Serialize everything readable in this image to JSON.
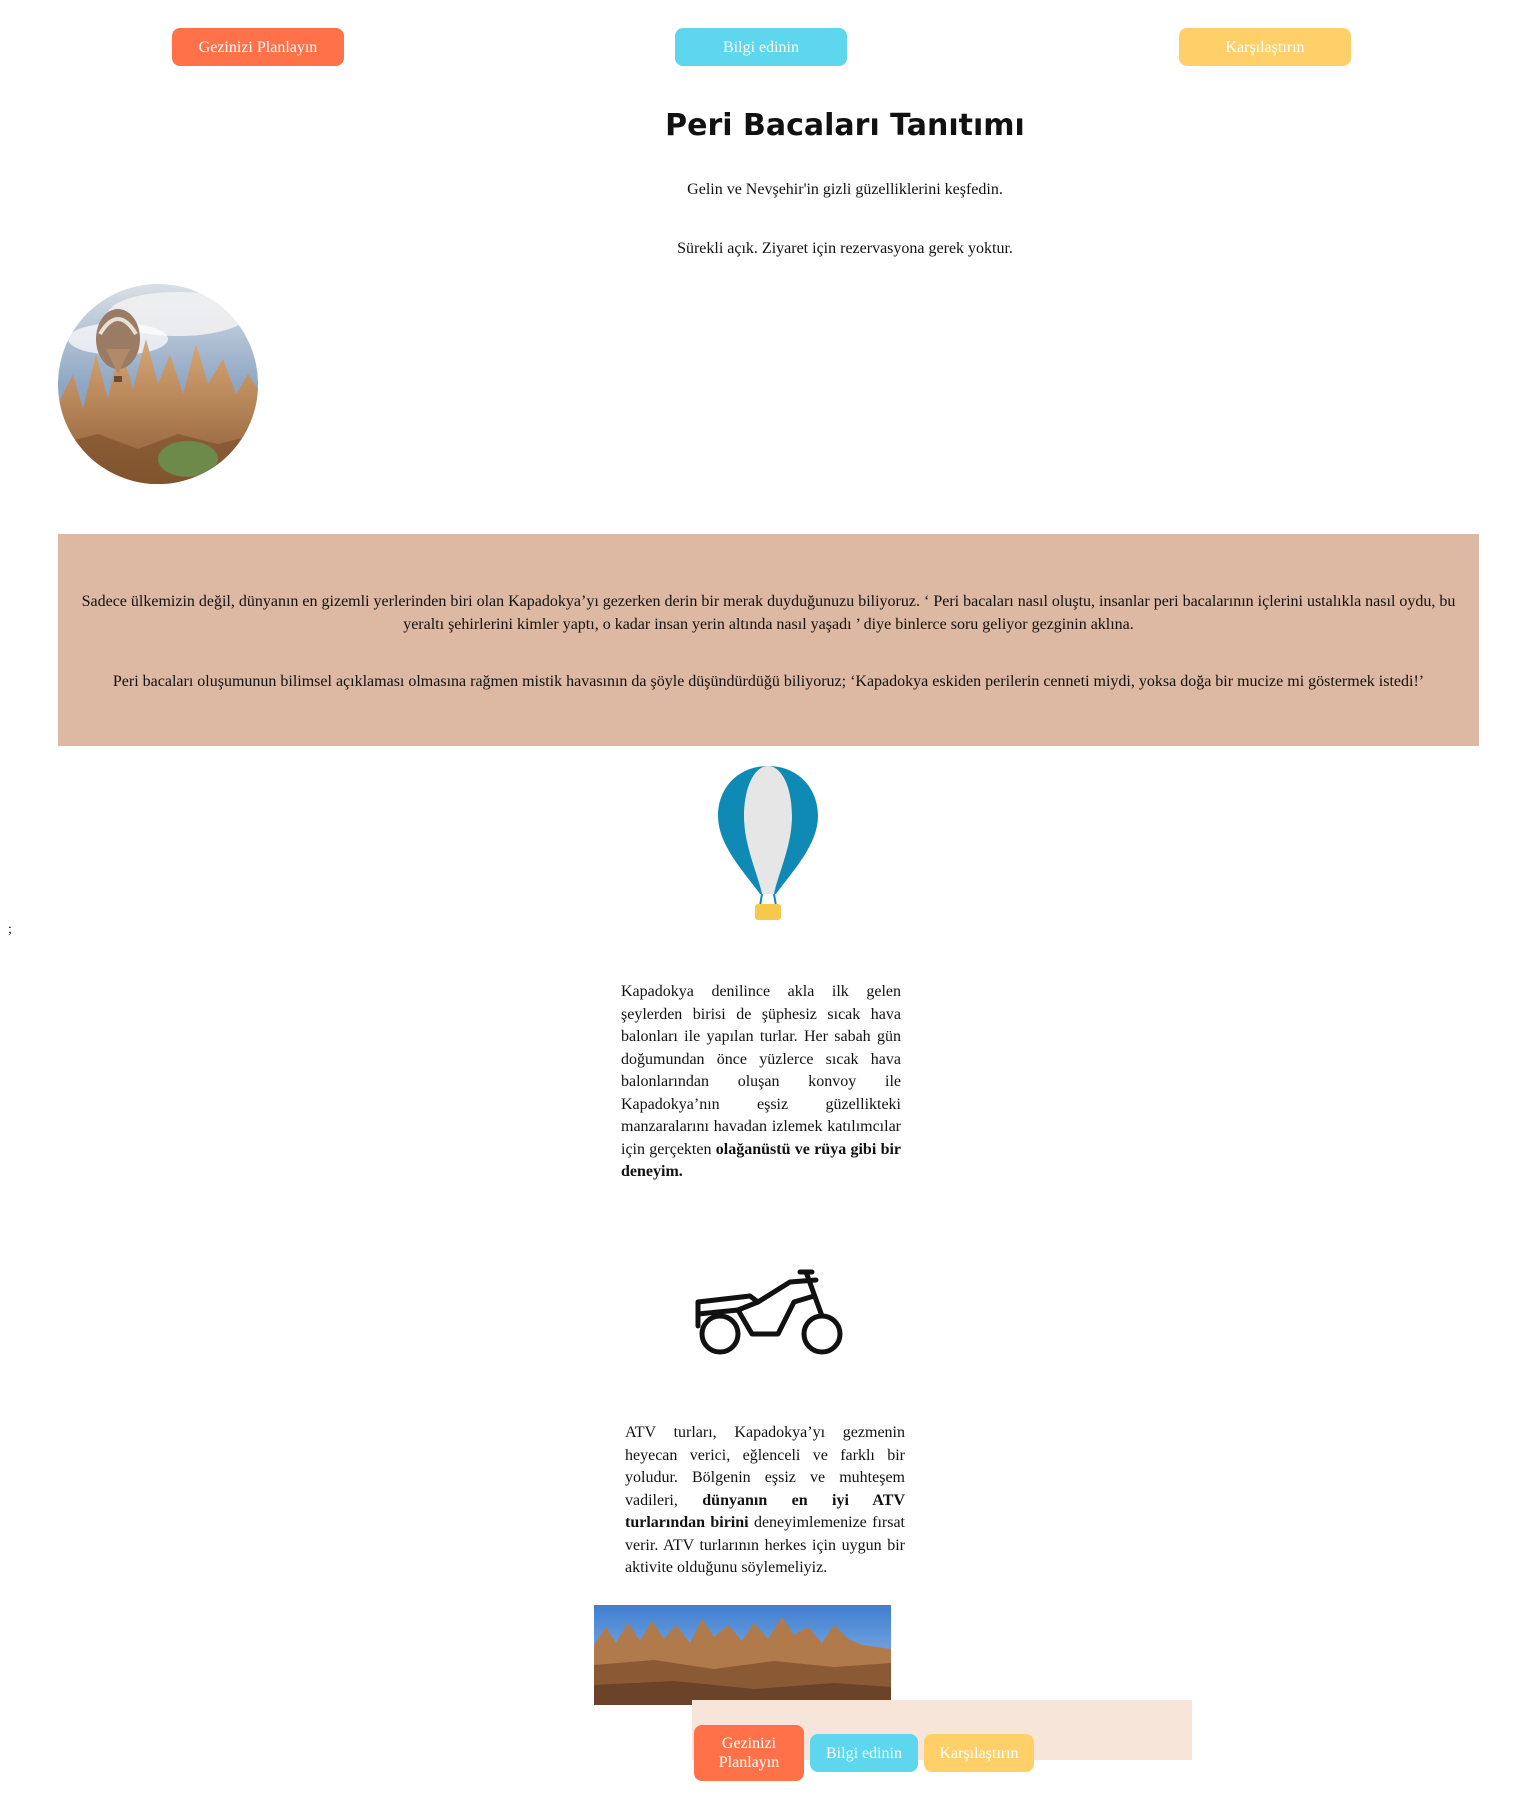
{
  "nav": {
    "plan_label": "Gezinizi Planlayın",
    "info_label": "Bilgi edinin",
    "compare_label": "Karşılaştırın"
  },
  "header": {
    "title": "Peri Bacaları Tanıtımı",
    "subtitle": "Gelin ve Nevşehir'in gizli güzelliklerini keşfedin.",
    "notice": "Sürekli açık. Ziyaret için rezervasyona gerek yoktur."
  },
  "intro": {
    "paragraph1": "Sadece ülkemizin değil, dünyanın en gizemli yerlerinden biri olan Kapadokya’yı gezerken derin bir merak duyduğunuzu biliyoruz. ‘ Peri bacaları nasıl oluştu, insanlar peri bacalarının içlerini ustalıkla nasıl oydu, bu yeraltı şehirlerini kimler yaptı, o kadar insan yerin altında nasıl yaşadı ’ diye binlerce soru geliyor gezginin aklına.",
    "paragraph2": "Peri bacaları oluşumunun bilimsel açıklaması olmasına rağmen mistik havasının da şöyle düşündürdüğü biliyoruz; ‘Kapadokya eskiden perilerin cenneti miydi, yoksa doğa bir mucize mi göstermek istedi!’"
  },
  "stray_text": ";",
  "balloon_section": {
    "icon": "hot-air-balloon-icon",
    "text": "Kapadokya denilince akla ilk gelen şeylerden birisi de şüphesiz sıcak hava balonları ile yapılan turlar. Her sabah gün doğumundan önce yüzlerce sıcak hava balonlarından oluşan konvoy ile Kapadokya’nın eşsiz güzellikteki manzaralarını havadan izlemek katılımcılar için gerçekten",
    "bold": "olağanüstü ve rüya gibi bir deneyim."
  },
  "atv_section": {
    "icon": "atv-motorcycle-icon",
    "text_before": "ATV turları, Kapadokya’yı gezmenin heyecan verici, eğlenceli ve farklı bir yoludur. Bölgenin eşsiz ve muhteşem vadileri,",
    "bold": "dünyanın en iyi ATV turlarından birini",
    "text_after": "deneyimlemenize fırsat verir. ATV turlarının herkes için uygun bir aktivite olduğunu söylemeliyiz."
  },
  "footer_nav": {
    "plan_label": "Gezinizi Planlayın",
    "info_label": "Bilgi edinin",
    "compare_label": "Karşılaştırın"
  },
  "colors": {
    "orange": "#ff7249",
    "blue": "#5dd6ee",
    "yellow": "#ffd06a",
    "intro_bg": "#ddb8a2",
    "footer_bg": "#f8e5d9"
  }
}
